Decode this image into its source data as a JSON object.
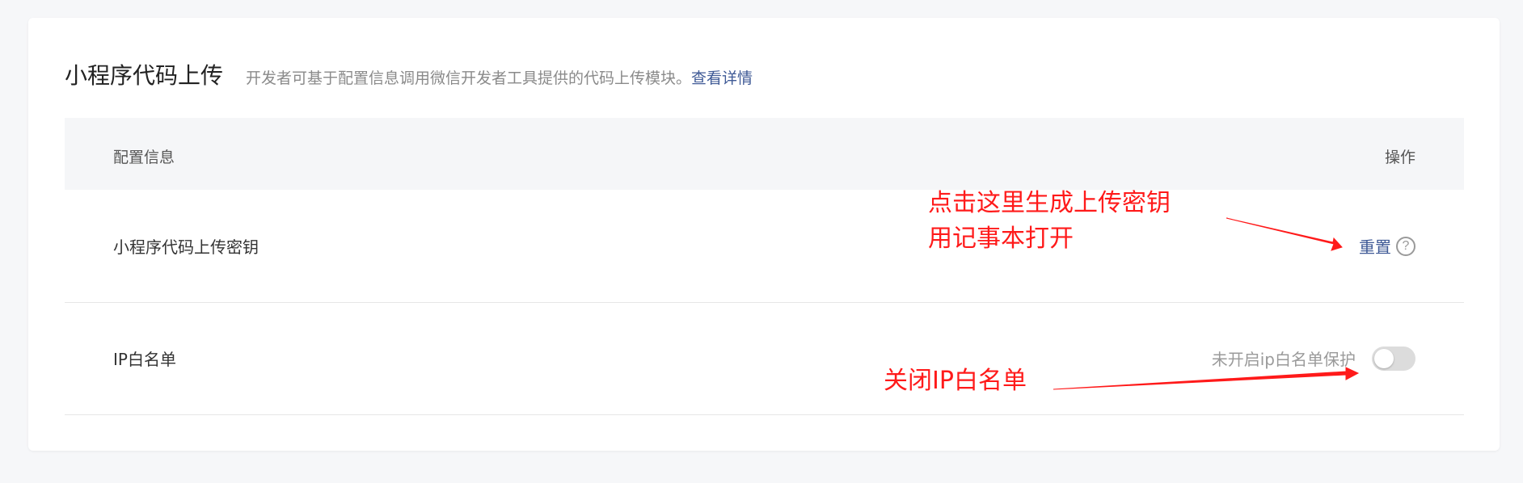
{
  "header": {
    "title": "小程序代码上传",
    "description": "开发者可基于配置信息调用微信开发者工具提供的代码上传模块。",
    "details_link": "查看详情"
  },
  "table": {
    "col_config": "配置信息",
    "col_action": "操作"
  },
  "rows": [
    {
      "label": "小程序代码上传密钥",
      "action_label": "重置",
      "help_icon": "question-circle-icon"
    },
    {
      "label": "IP白名单",
      "switch_text": "未开启ip白名单保护",
      "switch_on": false
    }
  ],
  "annotations": {
    "note1_line1": "点击这里生成上传密钥",
    "note1_line2": "用记事本打开",
    "note2": "关闭IP白名单"
  },
  "colors": {
    "link": "#3f5a96",
    "annotation": "#ff1a1a"
  }
}
